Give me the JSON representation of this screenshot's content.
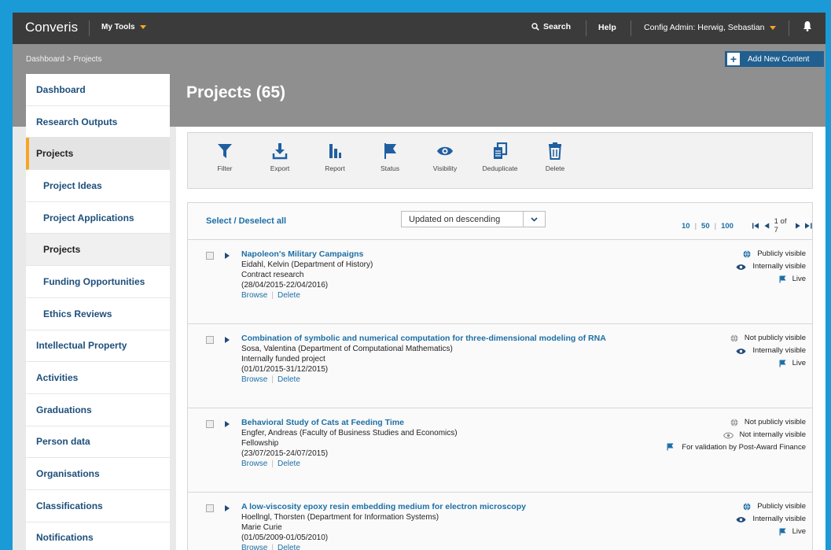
{
  "app": {
    "brand": "Converis",
    "my_tools": "My Tools",
    "search": "Search",
    "help": "Help",
    "user": "Config Admin: Herwig, Sebastian"
  },
  "breadcrumb": "Dashboard > Projects",
  "add_button": "Add New Content",
  "page_title": "Projects (65)",
  "sidebar": [
    {
      "label": "Dashboard"
    },
    {
      "label": "Research Outputs"
    },
    {
      "label": "Projects"
    },
    {
      "label": "Project Ideas"
    },
    {
      "label": "Project Applications"
    },
    {
      "label": "Projects"
    },
    {
      "label": "Funding Opportunities"
    },
    {
      "label": "Ethics Reviews"
    },
    {
      "label": "Intellectual Property"
    },
    {
      "label": "Activities"
    },
    {
      "label": "Graduations"
    },
    {
      "label": "Person data"
    },
    {
      "label": "Organisations"
    },
    {
      "label": "Classifications"
    },
    {
      "label": "Notifications"
    }
  ],
  "toolbar": [
    {
      "label": "Filter",
      "icon": "filter-icon"
    },
    {
      "label": "Export",
      "icon": "download-icon"
    },
    {
      "label": "Report",
      "icon": "bar-chart-icon"
    },
    {
      "label": "Status",
      "icon": "flag-icon"
    },
    {
      "label": "Visibility",
      "icon": "eye-icon"
    },
    {
      "label": "Deduplicate",
      "icon": "copy-icon"
    },
    {
      "label": "Delete",
      "icon": "trash-icon"
    }
  ],
  "list": {
    "select_all": "Select / Deselect all",
    "sort": "Updated on descending",
    "page_sizes": [
      "10",
      "50",
      "100"
    ],
    "page_info": "1 of 7"
  },
  "rows": [
    {
      "title": "Napoleon's Military Campaigns",
      "person": "Eidahl, Kelvin (Department of History)",
      "type": "Contract research",
      "dates": "(28/04/2015-22/04/2016)",
      "browse": "Browse",
      "delete": "Delete",
      "status": [
        {
          "text": "Publicly visible",
          "icon": "globe-icon",
          "color": "#1d6fa5"
        },
        {
          "text": "Internally visible",
          "icon": "eye-icon",
          "color": "#1f4b78"
        },
        {
          "text": "Live",
          "icon": "flag-icon",
          "color": "#1d6fa5"
        }
      ]
    },
    {
      "title": "Combination of symbolic and numerical computation for three-dimensional modeling of RNA",
      "person": "Sosa, Valentina (Department of Computational Mathematics)",
      "type": "Internally funded project",
      "dates": "(01/01/2015-31/12/2015)",
      "browse": "Browse",
      "delete": "Delete",
      "status": [
        {
          "text": "Not publicly visible",
          "icon": "globe-icon",
          "color": "#999999"
        },
        {
          "text": "Internally visible",
          "icon": "eye-icon",
          "color": "#1f4b78"
        },
        {
          "text": "Live",
          "icon": "flag-icon",
          "color": "#1d6fa5"
        }
      ]
    },
    {
      "title": "Behavioral Study of Cats at Feeding Time",
      "person": "Engfer, Andreas (Faculty of Business Studies and Economics)",
      "type": "Fellowship",
      "dates": "(23/07/2015-24/07/2015)",
      "browse": "Browse",
      "delete": "Delete",
      "status": [
        {
          "text": "Not publicly visible",
          "icon": "globe-icon",
          "color": "#999999"
        },
        {
          "text": "Not internally visible",
          "icon": "eye-icon",
          "color": "#999999"
        },
        {
          "text": "For validation by Post-Award Finance",
          "icon": "flag-icon",
          "color": "#1d6fa5"
        }
      ]
    },
    {
      "title": "A low-viscosity epoxy resin embedding medium for electron microscopy",
      "person": "Hoellngl, Thorsten (Department for Information Systems)",
      "type": "Marie Curie",
      "dates": "(01/05/2009-01/05/2010)",
      "browse": "Browse",
      "delete": "Delete",
      "status": [
        {
          "text": "Publicly visible",
          "icon": "globe-icon",
          "color": "#1d6fa5"
        },
        {
          "text": "Internally visible",
          "icon": "eye-icon",
          "color": "#1f4b78"
        },
        {
          "text": "Live",
          "icon": "flag-icon",
          "color": "#1d6fa5"
        }
      ]
    }
  ],
  "colors": {
    "accent": "#f5a623",
    "link": "#1d6fa5",
    "frame": "#1a9ad6"
  }
}
